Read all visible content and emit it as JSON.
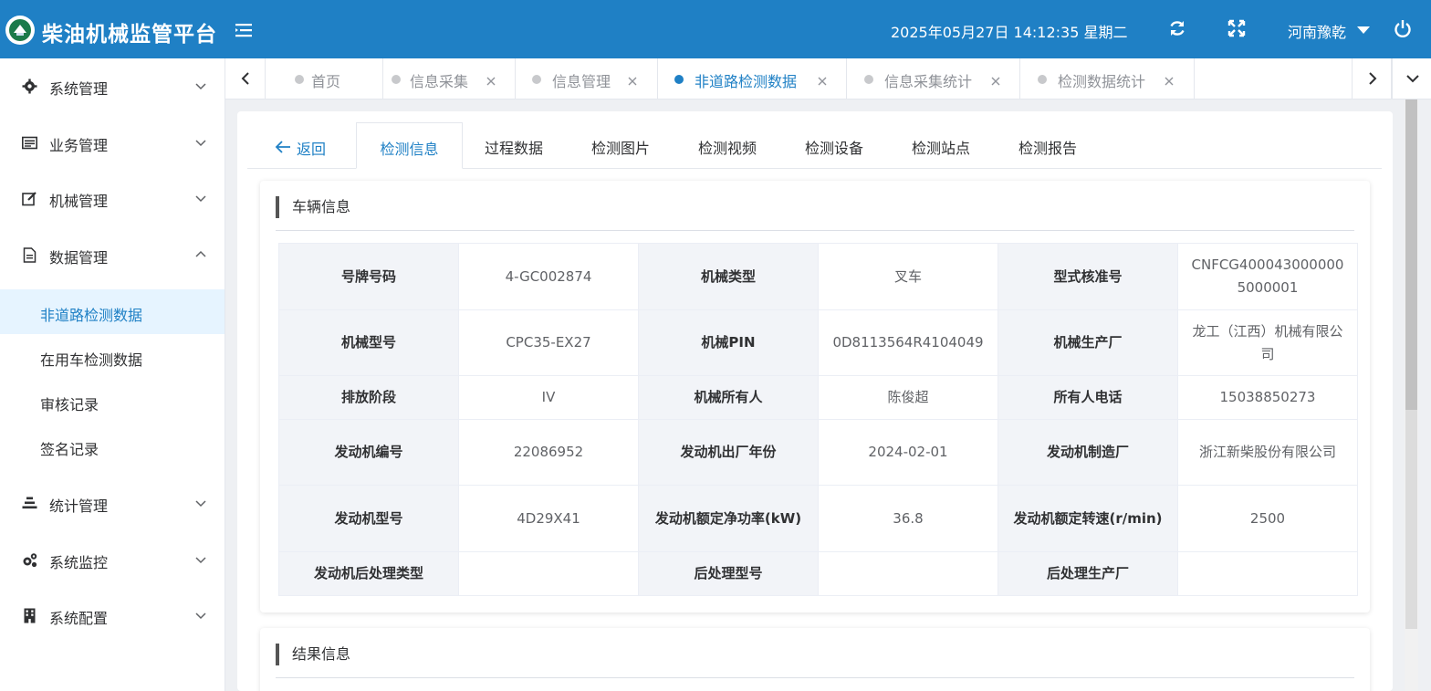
{
  "header": {
    "title": "柴油机械监管平台",
    "datetime": "2025年05月27日 14:12:35 星期二",
    "user": "河南豫乾"
  },
  "sidebar": {
    "items": [
      {
        "label": "系统管理",
        "icon": "gear-icon"
      },
      {
        "label": "业务管理",
        "icon": "list-card-icon"
      },
      {
        "label": "机械管理",
        "icon": "edit-icon"
      },
      {
        "label": "数据管理",
        "icon": "document-icon",
        "expanded": true
      },
      {
        "label": "统计管理",
        "icon": "stats-icon"
      },
      {
        "label": "系统监控",
        "icon": "cogs-icon"
      },
      {
        "label": "系统配置",
        "icon": "building-icon"
      }
    ],
    "sub_items": [
      {
        "label": "非道路检测数据",
        "active": true
      },
      {
        "label": "在用车检测数据"
      },
      {
        "label": "审核记录"
      },
      {
        "label": "签名记录"
      }
    ]
  },
  "tabs": [
    {
      "label": "首页",
      "closable": false
    },
    {
      "label": "信息采集",
      "closable": true
    },
    {
      "label": "信息管理",
      "closable": true
    },
    {
      "label": "非道路检测数据",
      "closable": true,
      "active": true
    },
    {
      "label": "信息采集统计",
      "closable": true
    },
    {
      "label": "检测数据统计",
      "closable": true
    }
  ],
  "subtabs": {
    "back": "返回",
    "items": [
      "检测信息",
      "过程数据",
      "检测图片",
      "检测视频",
      "检测设备",
      "检测站点",
      "检测报告"
    ],
    "active_index": 0
  },
  "vehicle": {
    "title": "车辆信息",
    "rows": [
      [
        {
          "label": "号牌号码",
          "value": "4-GC002874"
        },
        {
          "label": "机械类型",
          "value": "叉车"
        },
        {
          "label": "型式核准号",
          "value": "CNFCG4000430000005000001"
        }
      ],
      [
        {
          "label": "机械型号",
          "value": "CPC35-EX27"
        },
        {
          "label": "机械PIN",
          "value": "0D8113564R4104049"
        },
        {
          "label": "机械生产厂",
          "value": "龙工（江西）机械有限公司"
        }
      ],
      [
        {
          "label": "排放阶段",
          "value": "IV"
        },
        {
          "label": "机械所有人",
          "value": "陈俊超"
        },
        {
          "label": "所有人电话",
          "value": "15038850273"
        }
      ],
      [
        {
          "label": "发动机编号",
          "value": "22086952"
        },
        {
          "label": "发动机出厂年份",
          "value": "2024-02-01"
        },
        {
          "label": "发动机制造厂",
          "value": "浙江新柴股份有限公司"
        }
      ],
      [
        {
          "label": "发动机型号",
          "value": "4D29X41"
        },
        {
          "label": "发动机额定净功率(kW)",
          "value": "36.8"
        },
        {
          "label": "发动机额定转速(r/min)",
          "value": "2500"
        }
      ],
      [
        {
          "label": "发动机后处理类型",
          "value": ""
        },
        {
          "label": "后处理型号",
          "value": ""
        },
        {
          "label": "后处理生产厂",
          "value": ""
        }
      ]
    ]
  },
  "result": {
    "title": "结果信息"
  },
  "colors": {
    "primary": "#1f80c5",
    "label_bg": "#f2f4f8",
    "active_bg": "#e6f4ff"
  }
}
